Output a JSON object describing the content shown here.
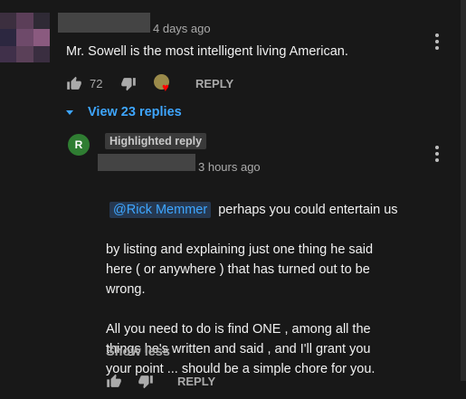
{
  "comment": {
    "time": "4 days ago",
    "text": "Mr. Sowell is the most intelligent living American.",
    "likes": "72",
    "reply_label": "REPLY",
    "view_replies": "View 23 replies"
  },
  "reply": {
    "avatar_letter": "R",
    "badge": "Highlighted reply",
    "time": "3 hours ago",
    "mention": "@Rick Memmer",
    "body_first": "perhaps you could entertain us",
    "body_rest": "by listing and explaining just one thing he said\nhere ( or anywhere ) that has turned out to be\nwrong.\n\nAll you need to do is find ONE , among all the\nthings he's written and said , and I'll grant you\nyour point ... should be a simple chore for you.",
    "show_less": "Show less",
    "reply_label": "REPLY"
  },
  "colors": {
    "background": "#181818",
    "link": "#3ea6ff",
    "avatar_green": "#2f7d32",
    "heart": "#ff0000"
  }
}
